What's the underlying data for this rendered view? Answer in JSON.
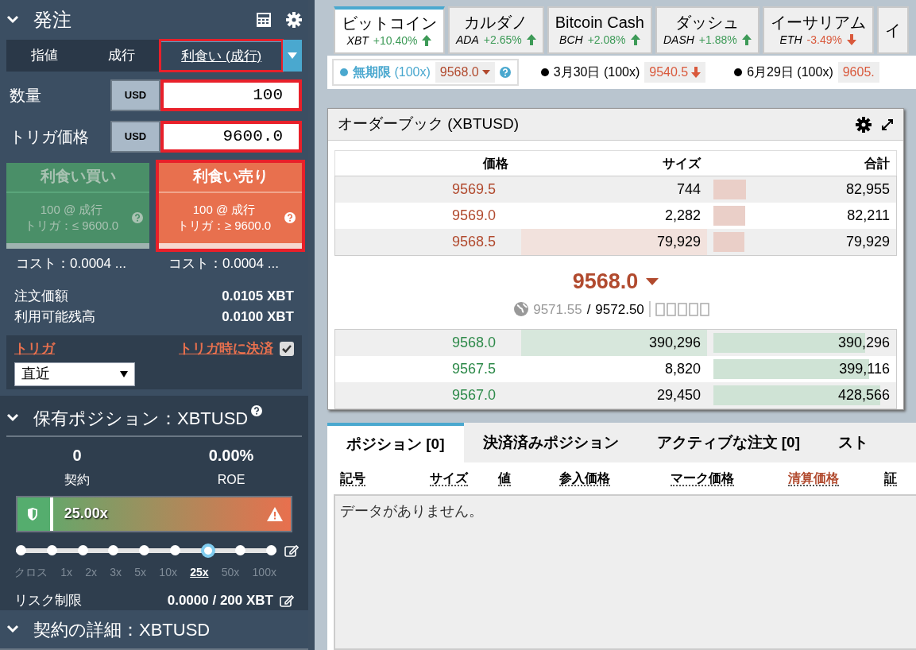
{
  "order_panel": {
    "title": "発注",
    "order_types": [
      {
        "label": "指値",
        "selected": false,
        "highlighted": false
      },
      {
        "label": "成行",
        "selected": false,
        "highlighted": false
      },
      {
        "label": "利食い (成行)",
        "selected": true,
        "highlighted": true
      }
    ],
    "fields": [
      {
        "label": "数量",
        "unit": "USD",
        "value": "100",
        "highlighted": true
      },
      {
        "label": "トリガ価格",
        "unit": "USD",
        "value": "9600.0",
        "highlighted": true
      }
    ],
    "actions": [
      {
        "kind": "buy",
        "title": "利食い買い",
        "line1": "100 @ 成行",
        "line2": "トリガ：≤ 9600.0",
        "disabled": true,
        "highlighted": false,
        "cost": "コスト：0.0004 ..."
      },
      {
        "kind": "sell",
        "title": "利食い売り",
        "line1": "100 @ 成行",
        "line2": "トリガ：≥ 9600.0",
        "disabled": false,
        "highlighted": true,
        "cost": "コスト：0.0004 ..."
      }
    ],
    "summary": [
      {
        "label": "注文価額",
        "value": "0.0105 XBT"
      },
      {
        "label": "利用可能残高",
        "value": "0.0100 XBT"
      }
    ],
    "trigger": {
      "label": "トリガ",
      "close_label": "トリガ時に決済",
      "close_checked": true,
      "select_value": "直近"
    }
  },
  "position_panel": {
    "title": "保有ポジション：XBTUSD",
    "contracts": "0",
    "contracts_label": "契約",
    "roe": "0.00%",
    "roe_label": "ROE",
    "leverage_bar": {
      "value": "25.00x",
      "level": 0.13
    },
    "leverage_stops": [
      {
        "label": "クロス",
        "selected": false
      },
      {
        "label": "1x",
        "selected": false
      },
      {
        "label": "2x",
        "selected": false
      },
      {
        "label": "3x",
        "selected": false
      },
      {
        "label": "5x",
        "selected": false
      },
      {
        "label": "10x",
        "selected": false
      },
      {
        "label": "25x",
        "selected": true
      },
      {
        "label": "50x",
        "selected": false
      },
      {
        "label": "100x",
        "selected": false
      }
    ],
    "risk_limit": {
      "label": "リスク制限",
      "value": "0.0000 / 200 XBT"
    }
  },
  "contract_panel": {
    "title": "契約の詳細：XBTUSD"
  },
  "instrument_tabs": [
    {
      "name": "ビットコイン",
      "symbol": "XBT",
      "change": "+10.40%",
      "kind": "up",
      "selected": true
    },
    {
      "name": "カルダノ",
      "symbol": "ADA",
      "change": "+2.65%",
      "kind": "up",
      "selected": false
    },
    {
      "name": "Bitcoin Cash",
      "symbol": "BCH",
      "change": "+2.08%",
      "kind": "up",
      "selected": false
    },
    {
      "name": "ダッシュ",
      "symbol": "DASH",
      "change": "+1.88%",
      "kind": "up",
      "selected": false
    },
    {
      "name": "イーサリアム",
      "symbol": "ETH",
      "change": "-3.49%",
      "kind": "down",
      "selected": false
    },
    {
      "name": "イ",
      "selected": false
    }
  ],
  "contracts": [
    {
      "name": "無期限",
      "leverage": "(100x)",
      "price": "9568.0",
      "selected": true
    },
    {
      "name": "3月30日",
      "leverage": "(100x)",
      "price": "9540.5",
      "selected": false
    },
    {
      "name": "6月29日",
      "leverage": "(100x)",
      "price": "9605.",
      "selected": false
    }
  ],
  "order_book": {
    "title": "オーダーブック (XBTUSD)",
    "columns": [
      "価格",
      "サイズ",
      "合計"
    ],
    "asks": [
      {
        "price": "9569.5",
        "size": "744",
        "total": "82,955",
        "size_highlighted": false
      },
      {
        "price": "9569.0",
        "size": "2,282",
        "total": "82,211",
        "size_highlighted": false
      },
      {
        "price": "9568.5",
        "size": "79,929",
        "total": "79,929",
        "size_highlighted": true
      }
    ],
    "last_price": "9568.0",
    "index_price": "9571.55",
    "price_separator": "/",
    "fair_price": "9572.50",
    "bids": [
      {
        "price": "9568.0",
        "size": "390,296",
        "total": "390,296",
        "size_highlighted": true
      },
      {
        "price": "9567.5",
        "size": "8,820",
        "total": "399,116",
        "size_highlighted": false
      },
      {
        "price": "9567.0",
        "size": "29,450",
        "total": "428,566",
        "size_highlighted": false
      }
    ]
  },
  "bottom_tabs": [
    {
      "label": "ポジション [0]",
      "selected": true
    },
    {
      "label": "決済済みポジション",
      "selected": false
    },
    {
      "label": "アクティブな注文 [0]",
      "selected": false
    },
    {
      "label": "スト",
      "selected": false
    }
  ],
  "position_columns": [
    {
      "label": "記号",
      "accent": false
    },
    {
      "label": "サイズ",
      "accent": false
    },
    {
      "label": "値",
      "accent": false
    },
    {
      "label": "参入価格",
      "accent": false
    },
    {
      "label": "マーク価格",
      "accent": false
    },
    {
      "label": "清算価格",
      "accent": true
    },
    {
      "label": "証",
      "accent": false
    }
  ],
  "empty_message": "データがありません。"
}
